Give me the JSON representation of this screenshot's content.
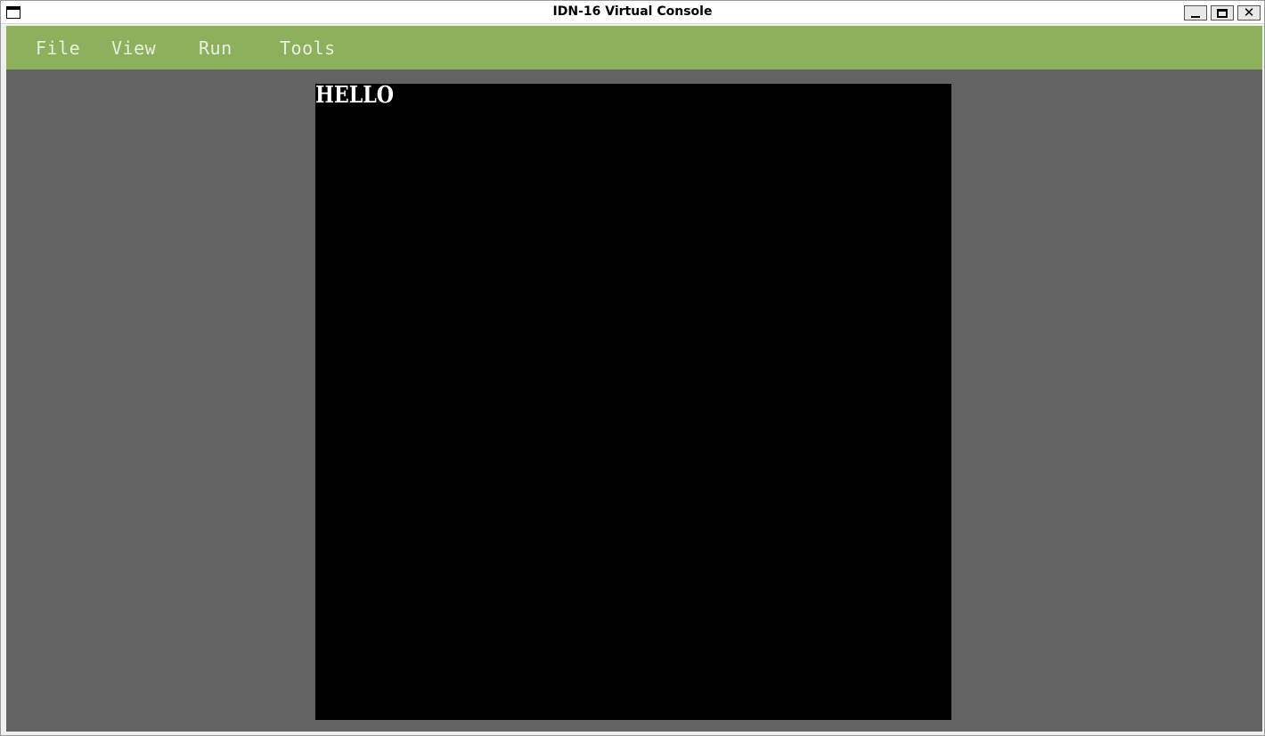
{
  "window": {
    "title": "IDN-16 Virtual Console",
    "controls": {
      "minimize_icon": "minimize-icon",
      "maximize_icon": "maximize-icon",
      "close_icon": "close-icon",
      "close_glyph": "✕"
    }
  },
  "menubar": {
    "items": [
      {
        "label": "File"
      },
      {
        "label": "View"
      },
      {
        "label": "Run"
      },
      {
        "label": "Tools"
      }
    ]
  },
  "screen": {
    "text": "HELLO"
  },
  "colors": {
    "menubar_bg": "#8db05c",
    "menu_text": "#e8efe0",
    "client_bg": "#636363",
    "screen_bg": "#000000",
    "screen_text": "#ffffff"
  }
}
